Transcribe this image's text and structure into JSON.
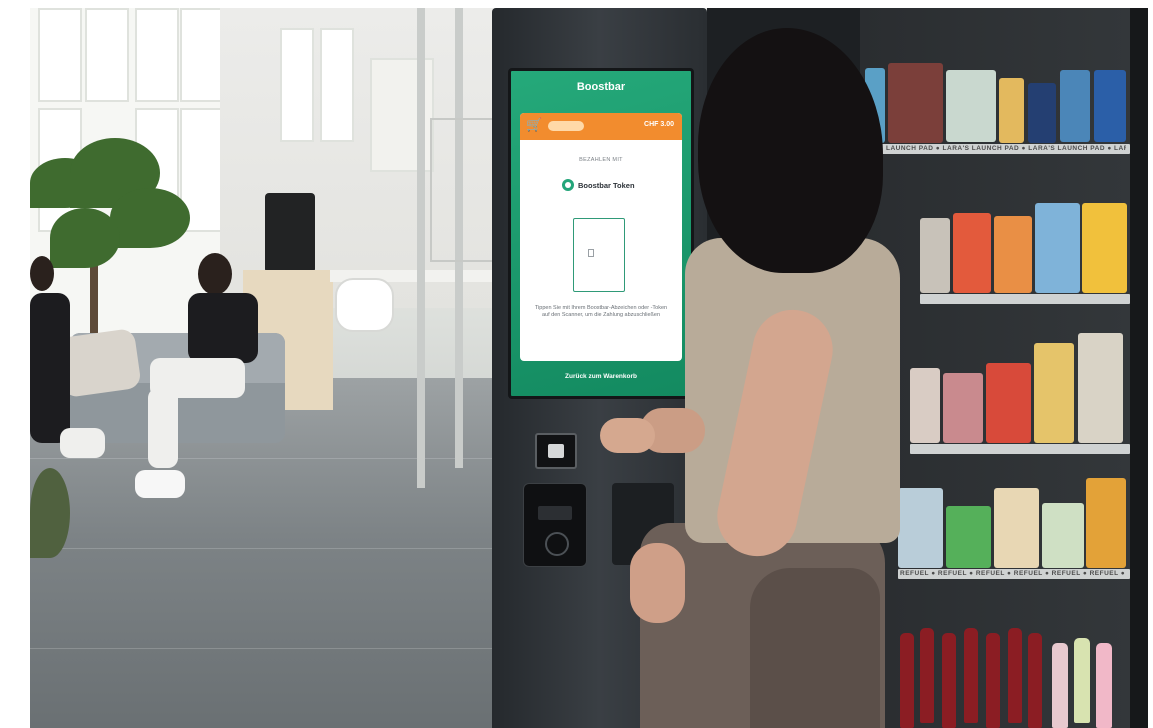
{
  "kiosk_screen": {
    "brand": "Boostbar",
    "price": "CHF 3.00",
    "pay_label": "BEZAHLEN MIT",
    "token_name": "Boostbar Token",
    "hint": "Tippen Sie mit Ihrem Boostbar-Abzeichen oder -Token auf den Scanner, um die Zahlung abzuschließen",
    "back_link": "Zurück zum Warenkorb",
    "accent_color": "#1e9b6e",
    "bar_color": "#f28c2e"
  },
  "fridge": {
    "shelf_top_label": "LAUNCH PAD ● LARA'S LAUNCH PAD ● LARA'S LAUNCH PAD ● LARA'S LAUN",
    "shelf_bottom_label": "REFUEL ● REFUEL ● REFUEL ● REFUEL ● REFUEL ● REFUEL ● REFUEL"
  },
  "icons": {
    "cart": "cart-icon",
    "token": "token-icon"
  }
}
